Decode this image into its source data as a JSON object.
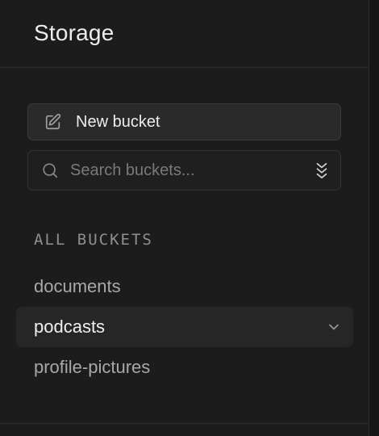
{
  "header": {
    "title": "Storage"
  },
  "actions": {
    "new_bucket_label": "New bucket"
  },
  "search": {
    "placeholder": "Search buckets...",
    "value": ""
  },
  "section": {
    "label": "ALL BUCKETS"
  },
  "buckets": [
    {
      "name": "documents",
      "selected": false
    },
    {
      "name": "podcasts",
      "selected": true
    },
    {
      "name": "profile-pictures",
      "selected": false
    }
  ],
  "icons": {
    "new_bucket": "edit-icon",
    "search": "search-icon",
    "sort": "sort-chevrons-icon",
    "bucket_menu": "chevron-down-icon"
  },
  "colors": {
    "background": "#1c1c1c",
    "button_bg": "#2a2a2a",
    "selected_bg": "#262626",
    "text_primary": "#ededed",
    "text_muted": "#a8a8a8"
  }
}
